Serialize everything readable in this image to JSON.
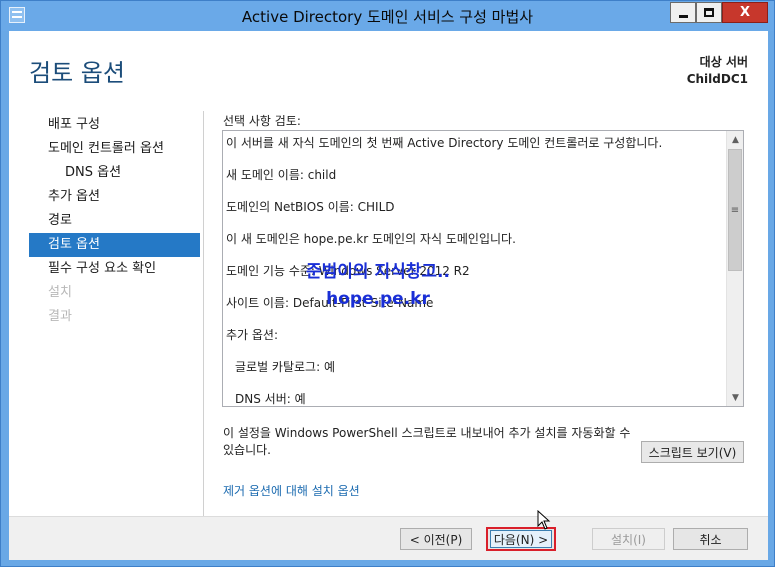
{
  "window": {
    "title": "Active Directory 도메인 서비스 구성 마법사",
    "controls": {
      "minimize": "minimize-icon",
      "maximize": "maximize-icon",
      "close": "close-icon",
      "close_glyph": "X"
    }
  },
  "header": {
    "page_title": "검토 옵션",
    "target_label": "대상 서버",
    "target_server": "ChildDC1"
  },
  "nav": {
    "items": [
      {
        "label": "배포 구성",
        "state": "normal"
      },
      {
        "label": "도메인 컨트롤러 옵션",
        "state": "normal"
      },
      {
        "label": "DNS 옵션",
        "state": "sub"
      },
      {
        "label": "추가 옵션",
        "state": "normal"
      },
      {
        "label": "경로",
        "state": "normal"
      },
      {
        "label": "검토 옵션",
        "state": "active"
      },
      {
        "label": "필수 구성 요소 확인",
        "state": "normal"
      },
      {
        "label": "설치",
        "state": "disabled"
      },
      {
        "label": "결과",
        "state": "disabled"
      }
    ]
  },
  "review": {
    "label": "선택 사항 검토:",
    "lines": [
      "이 서버를 새 자식 도메인의 첫 번째 Active Directory 도메인 컨트롤러로 구성합니다.",
      "새 도메인 이름: child",
      "도메인의 NetBIOS 이름: CHILD",
      "이 새 도메인은 hope.pe.kr 도메인의 자식 도메인입니다.",
      "도메인 기능 수준: Windows Server 2012 R2",
      "사이트 이름: Default-First-Site-Name",
      "추가 옵션:",
      "글로벌 카탈로그: 예",
      "DNS 서버: 예"
    ],
    "scroll": {
      "up": "▲",
      "down": "▼",
      "thumb": "≡"
    }
  },
  "watermark": {
    "line1": "준범이의 지식창고..",
    "line2": "hope.pe.kr"
  },
  "powershell": {
    "text": "이 설정을 Windows PowerShell 스크립트로 내보내어 추가 설치를 자동화할 수 있습니다.",
    "script_button": "스크립트 보기(V)"
  },
  "link": {
    "text": "제거 옵션에 대해 설치 옵션"
  },
  "footer": {
    "prev": "< 이전(P)",
    "next": "다음(N) >",
    "install": "설치(I)",
    "cancel": "취소"
  },
  "colors": {
    "titlebar": "#6aa9e8",
    "active_nav": "#2579c6",
    "page_title": "#1c4d7a",
    "close_button": "#c7372c",
    "highlight_border": "#d91f2a",
    "link": "#1c6bb0"
  }
}
